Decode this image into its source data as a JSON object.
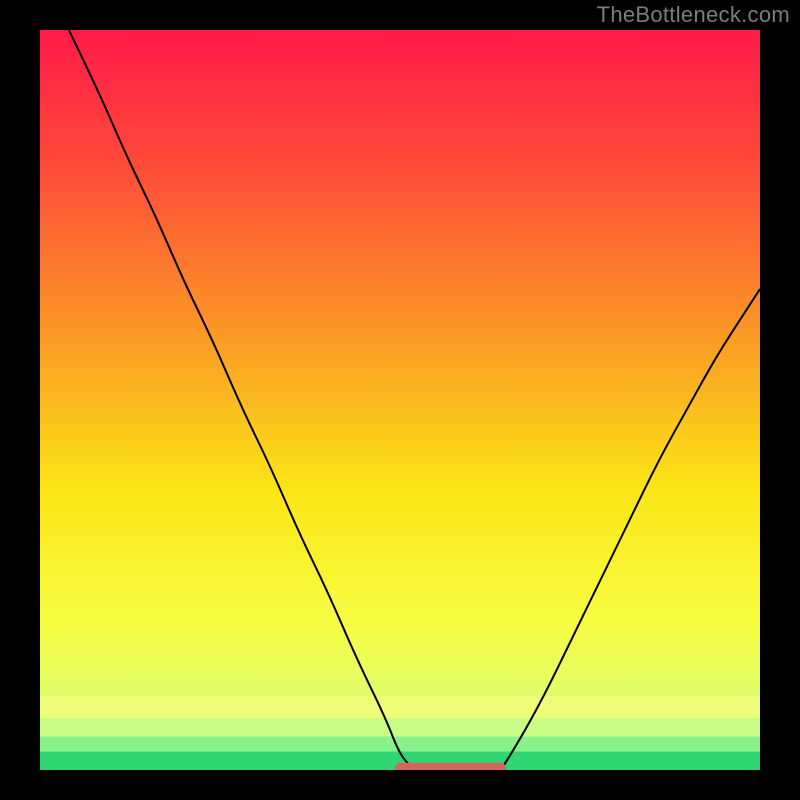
{
  "watermark": "TheBottleneck.com",
  "chart_data": {
    "type": "line",
    "title": "",
    "xlabel": "",
    "ylabel": "",
    "xlim": [
      0,
      100
    ],
    "ylim": [
      0,
      100
    ],
    "curve_left": {
      "comment": "left descending branch of the V curve",
      "x": [
        4,
        8,
        12,
        16,
        20,
        24,
        28,
        32,
        36,
        40,
        44,
        48,
        50,
        52
      ],
      "y": [
        100,
        92,
        83,
        75,
        66,
        58,
        49,
        41,
        32,
        24,
        15,
        7,
        2,
        0
      ]
    },
    "curve_right": {
      "comment": "right ascending branch of the V curve",
      "x": [
        64,
        66,
        70,
        74,
        78,
        82,
        86,
        90,
        94,
        98,
        100
      ],
      "y": [
        0,
        3,
        10,
        18,
        26,
        34,
        42,
        49,
        56,
        62,
        65
      ]
    },
    "flat_segment": {
      "comment": "thicker coral segment along the bottom between the two branches",
      "x": [
        50,
        64
      ],
      "y": [
        0.3,
        0.3
      ]
    },
    "gradient_stops": [
      {
        "offset": 0.0,
        "color": "#ff1a48"
      },
      {
        "offset": 0.18,
        "color": "#ff4a3a"
      },
      {
        "offset": 0.4,
        "color": "#fb9526"
      },
      {
        "offset": 0.62,
        "color": "#fbe516"
      },
      {
        "offset": 0.8,
        "color": "#f7fd42"
      },
      {
        "offset": 0.9,
        "color": "#e1fd6a"
      },
      {
        "offset": 0.96,
        "color": "#9cf98d"
      },
      {
        "offset": 1.0,
        "color": "#36e67a"
      }
    ],
    "bottom_bands": [
      {
        "y0": 0.9,
        "y1": 0.93,
        "color": "#eefc78"
      },
      {
        "y0": 0.93,
        "y1": 0.955,
        "color": "#c9fb87"
      },
      {
        "y0": 0.955,
        "y1": 0.975,
        "color": "#88f18b"
      },
      {
        "y0": 0.975,
        "y1": 1.0,
        "color": "#2fd673"
      }
    ]
  }
}
